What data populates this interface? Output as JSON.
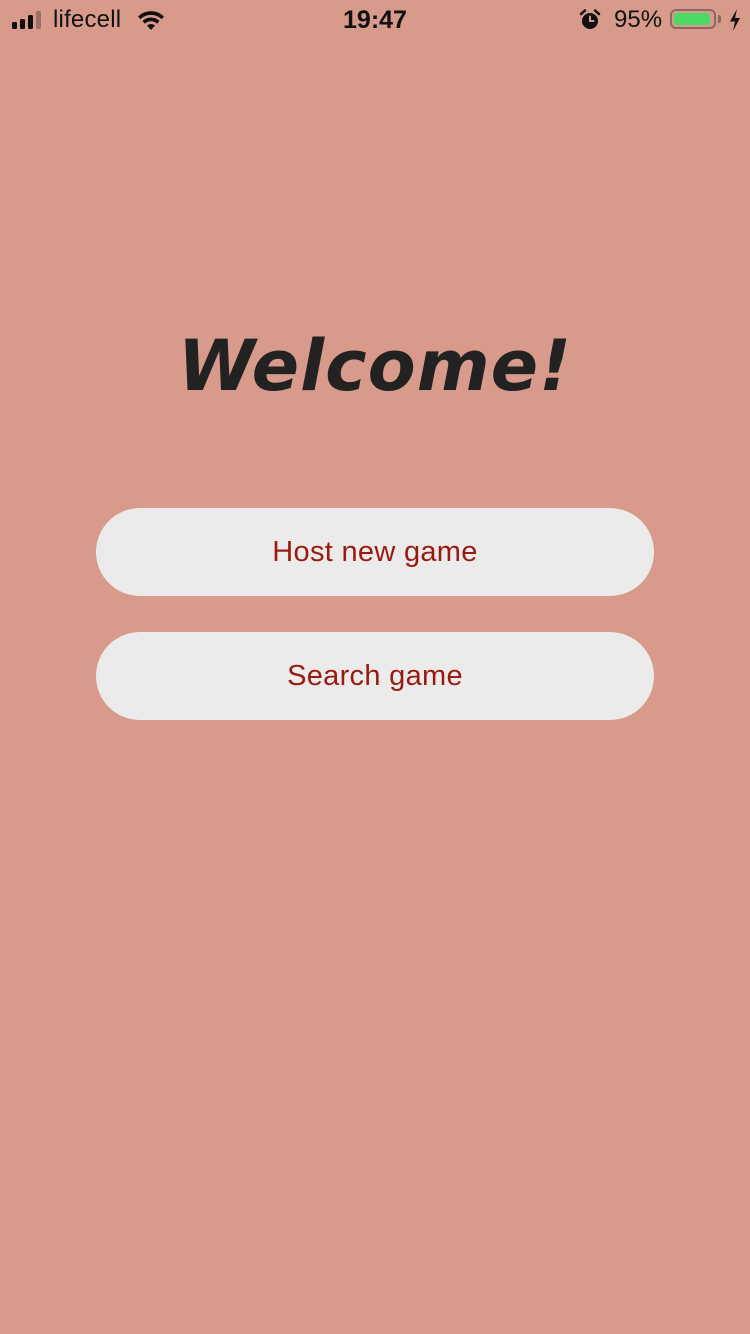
{
  "status_bar": {
    "carrier": "lifecell",
    "time": "19:47",
    "battery_percent": "95%",
    "battery_level": 0.95,
    "icons": [
      "signal-icon",
      "wifi-icon",
      "alarm-icon",
      "battery-icon",
      "charging-icon"
    ]
  },
  "main": {
    "title": "Welcome!",
    "buttons": {
      "host": "Host new game",
      "search": "Search game"
    }
  },
  "colors": {
    "background": "#D79A8B",
    "button_background": "#EBEBEB",
    "button_text": "#9A1A10",
    "title_text": "#222222",
    "battery_fill": "#4CD964"
  }
}
